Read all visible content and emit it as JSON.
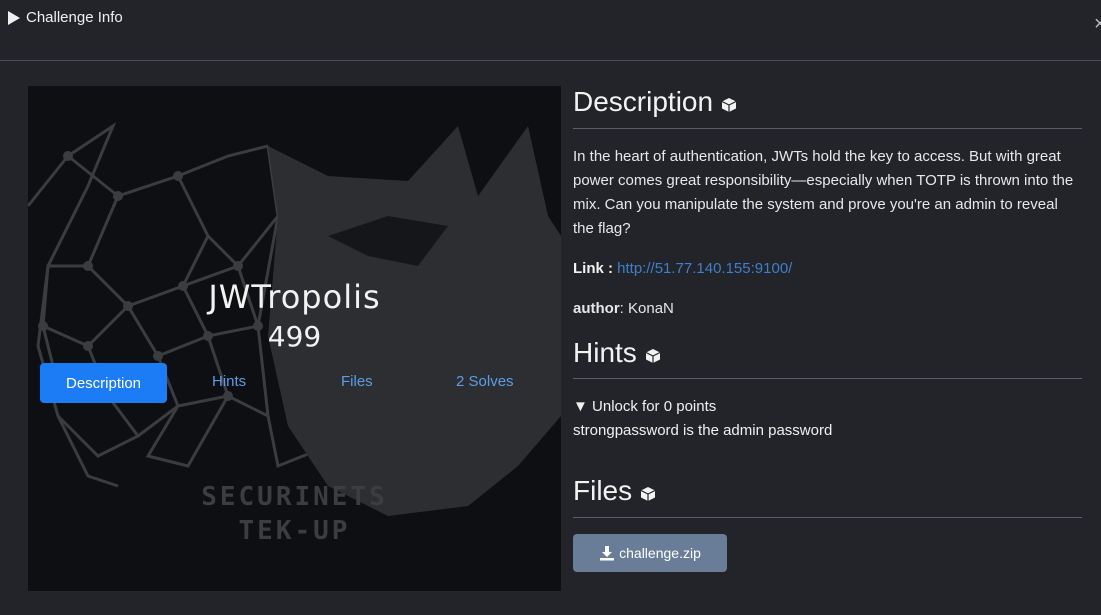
{
  "header": {
    "title": "Challenge Info",
    "close_symbol": "×"
  },
  "challenge": {
    "name": "JWTropolis",
    "points": "499"
  },
  "tabs": {
    "description": "Description",
    "hints": "Hints",
    "files": "Files",
    "solves": "2 Solves"
  },
  "banner_logo": {
    "line1": "SECURINETS",
    "line2": "TEK-UP"
  },
  "description": {
    "heading": "Description",
    "text": "In the heart of authentication, JWTs hold the key to access. But with great power comes great responsibility—especially when TOTP is thrown into the mix. Can you manipulate the system and prove you're an admin to reveal the flag?",
    "link_label": "Link :",
    "link_url": "http://51.77.140.155:9100/",
    "author_label": "author",
    "author_name": ": KonaN"
  },
  "hints": {
    "heading": "Hints",
    "summary": "Unlock for 0 points",
    "text": "strongpassword is the admin password"
  },
  "files": {
    "heading": "Files",
    "file_name": "challenge.zip"
  },
  "colors": {
    "accent": "#1b7cf5",
    "link": "#3f7fc9",
    "file_button": "#6a7d98",
    "background": "#222429"
  }
}
